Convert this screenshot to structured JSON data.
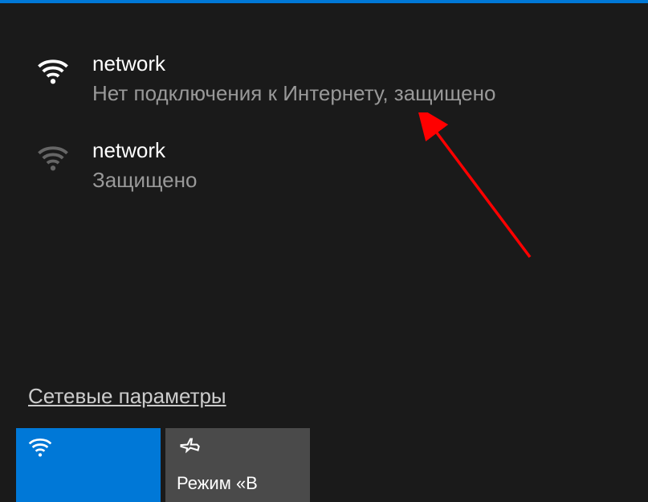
{
  "networks": [
    {
      "name": "network",
      "status": "Нет подключения к Интернету, защищено",
      "connected": true
    },
    {
      "name": "network",
      "status": "Защищено",
      "connected": false
    }
  ],
  "settings_link": "Сетевые параметры",
  "tiles": {
    "wifi": {
      "active": true
    },
    "airplane": {
      "label": "Режим «В",
      "active": false
    }
  },
  "colors": {
    "accent": "#0078d7",
    "background": "#1a1a1a",
    "tile_inactive": "#4a4a4a",
    "text_primary": "#ffffff",
    "text_secondary": "#999999"
  }
}
